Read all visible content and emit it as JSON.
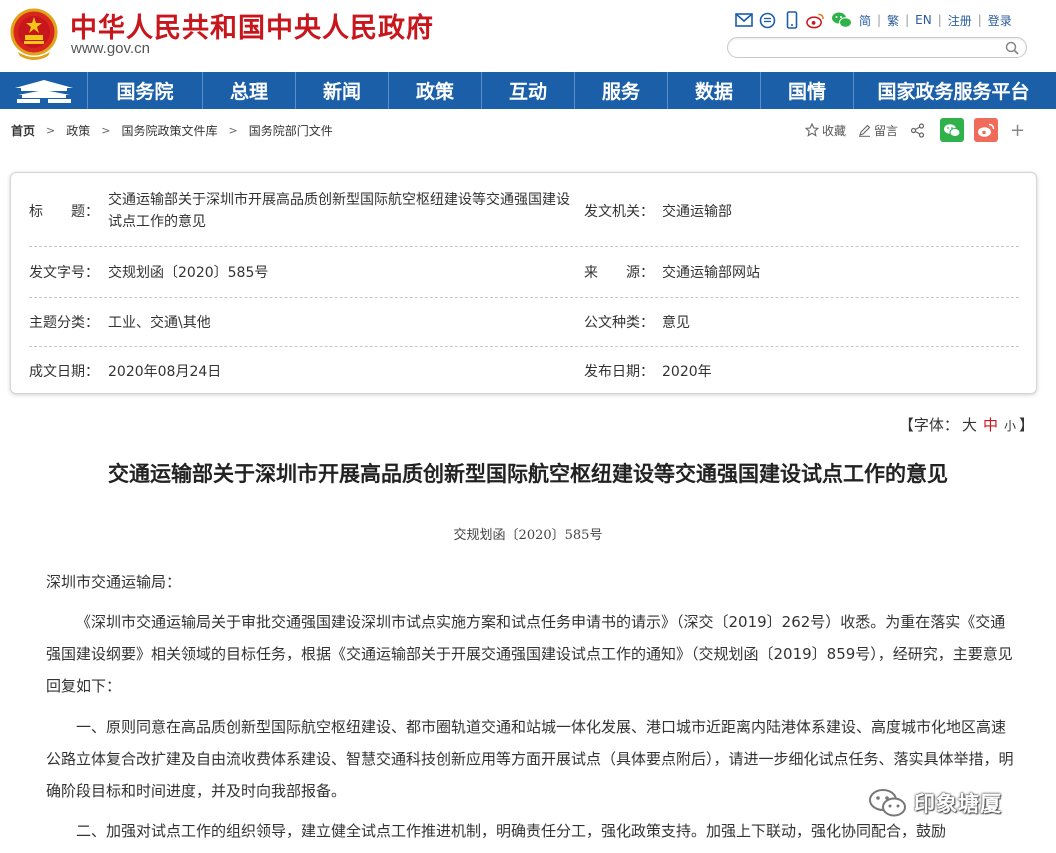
{
  "header": {
    "title": "中华人民共和国中央人民政府",
    "url": "www.gov.cn",
    "lang_simplified": "简",
    "lang_traditional": "繁",
    "lang_english": "EN",
    "register": "注册",
    "login": "登录",
    "search_placeholder": ""
  },
  "nav": {
    "items": [
      "国务院",
      "总理",
      "新闻",
      "政策",
      "互动",
      "服务",
      "数据",
      "国情",
      "国家政务服务平台"
    ]
  },
  "breadcrumb": {
    "items": [
      "首页",
      "政策",
      "国务院政策文件库",
      "国务院部门文件"
    ]
  },
  "actions": {
    "favorite": "收藏",
    "comment": "留言",
    "more": "+"
  },
  "info": {
    "title_label": "标　　题：",
    "title_value": "交通运输部关于深圳市开展高品质创新型国际航空枢纽建设等交通强国建设试点工作的意见",
    "issuer_label": "发文机关：",
    "issuer_value": "交通运输部",
    "docno_label": "发文字号：",
    "docno_value": "交规划函〔2020〕585号",
    "source_label": "来　　源：",
    "source_value": "交通运输部网站",
    "topic_label": "主题分类：",
    "topic_value": "工业、交通\\其他",
    "doctype_label": "公文种类：",
    "doctype_value": "意见",
    "date_label": "成文日期：",
    "date_value": "2020年08月24日",
    "pubdate_label": "发布日期：",
    "pubdate_value": "2020年"
  },
  "fontsize": {
    "open": "【字体：",
    "large": "大",
    "medium": "中",
    "small": "小",
    "close": "】"
  },
  "article": {
    "title": "交通运输部关于深圳市开展高品质创新型国际航空枢纽建设等交通强国建设试点工作的意见",
    "doc_number": "交规划函〔2020〕585号",
    "salutation": "深圳市交通运输局：",
    "para1": "《深圳市交通运输局关于审批交通强国建设深圳市试点实施方案和试点任务申请书的请示》（深交〔2019〕262号）收悉。为重在落实《交通强国建设纲要》相关领域的目标任务，根据《交通运输部关于开展交通强国建设试点工作的通知》（交规划函〔2019〕859号），经研究，主要意见回复如下：",
    "para2": "一、原则同意在高品质创新型国际航空枢纽建设、都市圈轨道交通和站城一体化发展、港口城市近距离内陆港体系建设、高度城市化地区高速公路立体复合改扩建及自由流收费体系建设、智慧交通科技创新应用等方面开展试点（具体要点附后），请进一步细化试点任务、落实具体举措，明确阶段目标和时间进度，并及时向我部报备。",
    "para3": "二、加强对试点工作的组织领导，建立健全试点工作推进机制，明确责任分工，强化政策支持。加强上下联动，强化协同配合，鼓励"
  },
  "watermark": {
    "text": "印象塘厦"
  },
  "colors": {
    "brand_red": "#c8161d",
    "nav_blue": "#1b5fa8",
    "wechat_green": "#2fb24a",
    "weibo_orange": "#f06c5a"
  }
}
